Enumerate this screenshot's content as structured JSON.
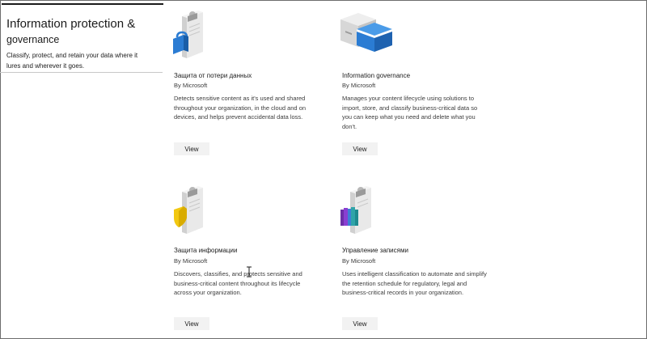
{
  "sidebar": {
    "title_line1": "Information protection &",
    "title_line2": "governance",
    "description": "Classify, protect, and retain your data where it lures and wherever it goes."
  },
  "cards": [
    {
      "title": "Защита от потери данных",
      "publisher": "By Microsoft",
      "description": "Detects sensitive content as it's used and shared throughout your organization, in the cloud and on devices, and helps prevent accidental data loss.",
      "button_label": "View",
      "icon": "clipboard-lock-icon"
    },
    {
      "title": "Information governance",
      "publisher": "By Microsoft",
      "description": "Manages your content lifecycle using solutions to import, store, and classify business-critical data so you can keep what you need and delete what you don't.",
      "button_label": "View",
      "icon": "archive-boxes-icon"
    },
    {
      "title": "Защита информации",
      "publisher": "By Microsoft",
      "description": "Discovers, classifies, and protects sensitive and business-critical content throughout its lifecycle across your organization.",
      "button_label": "View",
      "icon": "clipboard-shield-icon"
    },
    {
      "title": "Управление записями",
      "publisher": "By Microsoft",
      "description": "Uses intelligent classification to automate and simplify the retention schedule for regulatory, legal and business-critical records in your organization.",
      "button_label": "View",
      "icon": "clipboard-binders-icon"
    }
  ],
  "colors": {
    "accent_blue": "#2b7cd3",
    "shield_yellow": "#f2c811",
    "button_bg": "#f2f2f2"
  }
}
